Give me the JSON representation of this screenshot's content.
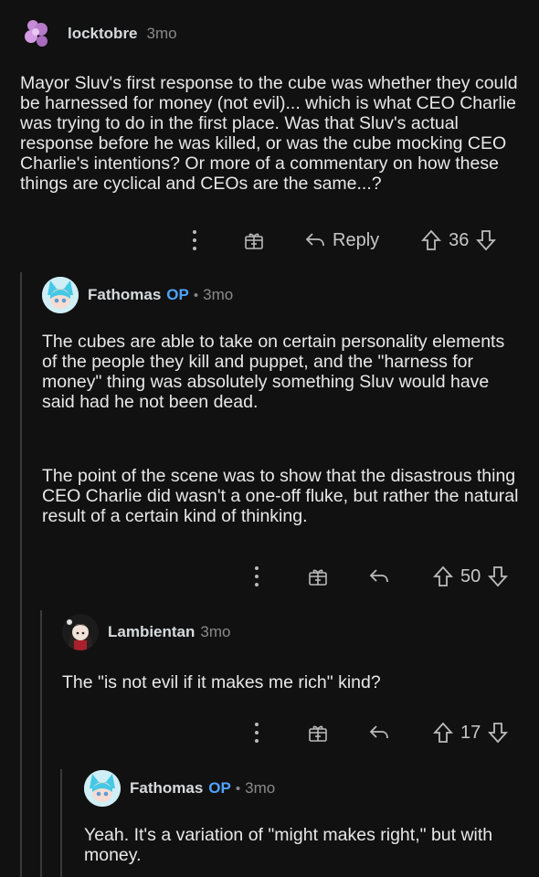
{
  "comments": [
    {
      "author": "locktobre",
      "op": "",
      "time": "3mo",
      "body": "Mayor Sluv's first response to the cube was whether they could be harnessed for money (not evil)... which is what CEO Charlie was trying to do in the first place. Was that Sluv's actual response before he was killed, or was the cube mocking CEO Charlie's intentions? Or more of a commentary on how these things are cyclical and CEOs are the same...?",
      "reply_label": "Reply",
      "score": "36"
    },
    {
      "author": "Fathomas",
      "op": "OP",
      "dot": "•",
      "time": "3mo",
      "body_p1": "The cubes are able to take on certain personality elements of the people they kill and puppet, and the \"harness for money\" thing was absolutely something Sluv would have said had he not been dead.",
      "body_p2": "The point of the scene was to show that the disastrous thing CEO Charlie did wasn't a one-off fluke, but rather the natural result of a certain kind of thinking.",
      "score": "50"
    },
    {
      "author": "Lambientan",
      "op": "",
      "time": "3mo",
      "body": "The \"is not evil if it makes me rich\" kind?",
      "score": "17"
    },
    {
      "author": "Fathomas",
      "op": "OP",
      "dot": "•",
      "time": "3mo",
      "body": "Yeah. It's a variation of \"might makes right,\" but with money."
    }
  ],
  "icons": {
    "more": "more-vertical-icon",
    "award": "award-icon",
    "reply": "reply-arrow-icon",
    "upvote": "upvote-icon",
    "downvote": "downvote-icon"
  },
  "colors": {
    "background": "#111111",
    "op_accent": "#4fa3ff",
    "text": "#e8e8e8",
    "meta": "#8a8a8a"
  }
}
